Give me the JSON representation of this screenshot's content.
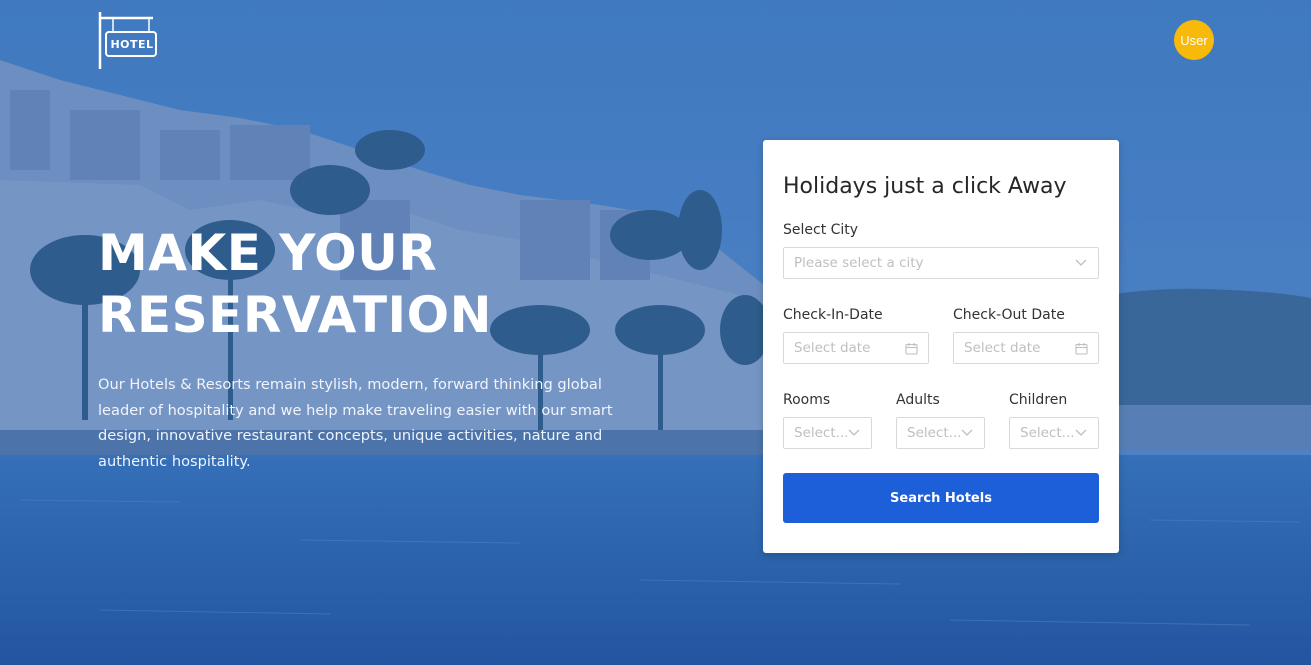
{
  "brand": {
    "logo_text": "HOTEL"
  },
  "user": {
    "avatar_label": "User"
  },
  "hero": {
    "title_line1": "MAKE YOUR",
    "title_line2": "RESERVATION",
    "description": "Our Hotels & Resorts remain stylish, modern, forward thinking global leader of hospitality and we help make traveling easier with our smart design, innovative restaurant concepts, unique activities, nature and authentic hospitality."
  },
  "form": {
    "title": "Holidays just a click Away",
    "city": {
      "label": "Select City",
      "placeholder": "Please select a city",
      "icon": "chevron-down-icon"
    },
    "check_in": {
      "label": "Check-In-Date",
      "placeholder": "Select date",
      "icon": "calendar-icon"
    },
    "check_out": {
      "label": "Check-Out Date",
      "placeholder": "Select date",
      "icon": "calendar-icon"
    },
    "rooms": {
      "label": "Rooms",
      "placeholder": "Select..."
    },
    "adults": {
      "label": "Adults",
      "placeholder": "Select..."
    },
    "children": {
      "label": "Children",
      "placeholder": "Select..."
    },
    "submit_label": "Search Hotels"
  },
  "colors": {
    "accent": "#1c5fd8",
    "avatar": "#f7b90a",
    "overlay": "#3d6fb8"
  }
}
